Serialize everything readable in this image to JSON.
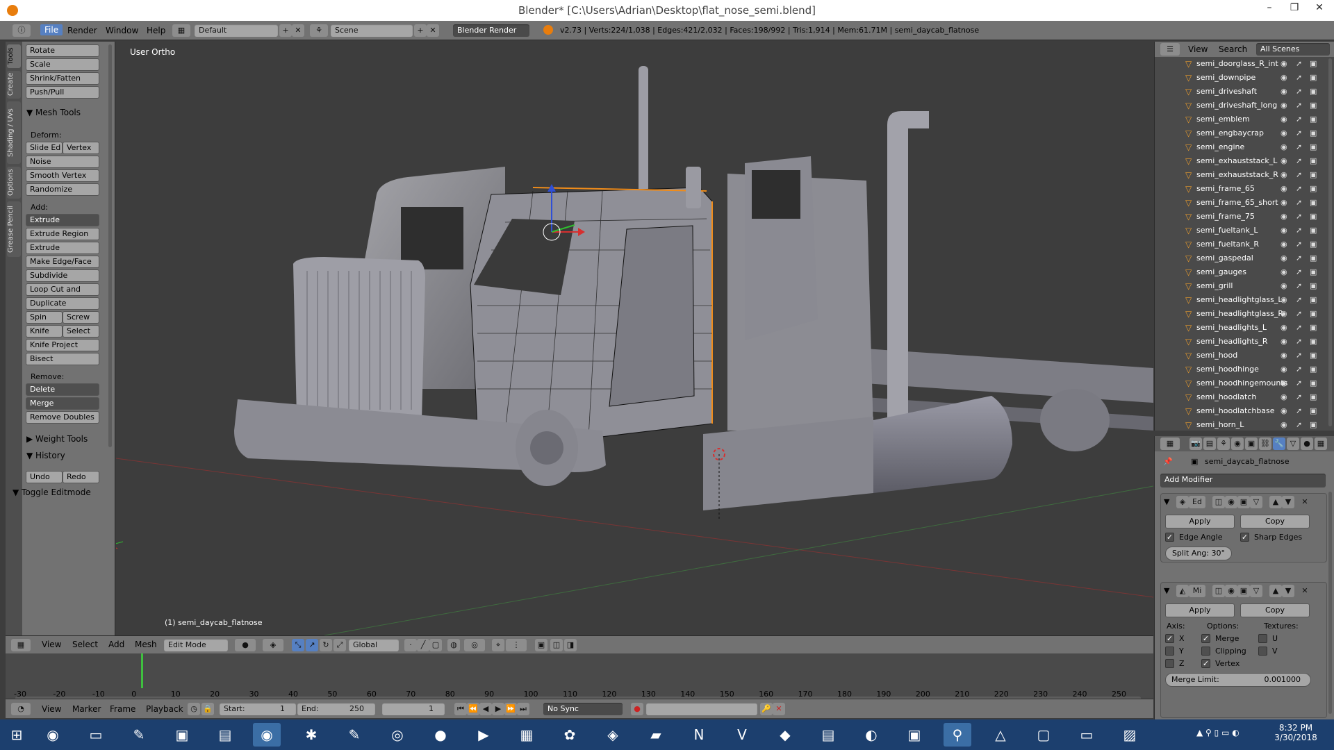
{
  "window": {
    "title": "Blender* [C:\\Users\\Adrian\\Desktop\\flat_nose_semi.blend]",
    "controls": [
      "–",
      "❐",
      "✕"
    ]
  },
  "info_header": {
    "menus": [
      "File",
      "Render",
      "Window",
      "Help"
    ],
    "layout": "Default",
    "scene": "Scene",
    "engine": "Blender Render",
    "stats": "v2.73 | Verts:224/1,038 | Edges:421/2,032 | Faces:198/992 | Tris:1,914 | Mem:61.71M | semi_daycab_flatnose"
  },
  "left_tabs": [
    "Tools",
    "Create",
    "Shading / UVs",
    "Options",
    "Grease Pencil"
  ],
  "tool_shelf": {
    "transform_buttons": [
      "Rotate",
      "Scale",
      "Shrink/Fatten",
      "Push/Pull"
    ],
    "mesh_tools_header": "Mesh Tools",
    "deform_label": "Deform:",
    "deform_row": [
      "Slide Ed",
      "Vertex"
    ],
    "deform_buttons": [
      "Noise",
      "Smooth Vertex",
      "Randomize"
    ],
    "add_label": "Add:",
    "extrude": "Extrude",
    "add_buttons": [
      "Extrude Region",
      "Extrude Individual",
      "Make Edge/Face",
      "Subdivide",
      "Loop Cut and Slide",
      "Duplicate"
    ],
    "spin_row": [
      "Spin",
      "Screw"
    ],
    "knife_row": [
      "Knife",
      "Select"
    ],
    "add_buttons2": [
      "Knife Project",
      "Bisect"
    ],
    "remove_label": "Remove:",
    "delete": "Delete",
    "merge": "Merge",
    "remove_doubles": "Remove Doubles",
    "weight_tools": "Weight Tools",
    "history": "History",
    "undo": "Undo",
    "redo": "Redo",
    "toggle_editmode": "Toggle Editmode"
  },
  "viewport": {
    "view_label": "User Ortho",
    "object_label": "(1) semi_daycab_flatnose"
  },
  "viewport_header": {
    "menus": [
      "View",
      "Select",
      "Add",
      "Mesh"
    ],
    "mode": "Edit Mode",
    "orientation": "Global"
  },
  "timeline": {
    "ticks": [
      "-30",
      "-20",
      "-10",
      "0",
      "10",
      "20",
      "30",
      "40",
      "50",
      "60",
      "70",
      "80",
      "90",
      "100",
      "110",
      "120",
      "130",
      "140",
      "150",
      "160",
      "170",
      "180",
      "190",
      "200",
      "210",
      "220",
      "230",
      "240",
      "250"
    ],
    "menus": [
      "View",
      "Marker",
      "Frame",
      "Playback"
    ],
    "start": "Start:",
    "start_val": "1",
    "end": "End:",
    "end_val": "250",
    "current": "1",
    "sync": "No Sync"
  },
  "outliner": {
    "menus": [
      "View",
      "Search"
    ],
    "filter": "All Scenes",
    "items": [
      "semi_doorglass_R_int",
      "semi_downpipe",
      "semi_driveshaft",
      "semi_driveshaft_long",
      "semi_emblem",
      "semi_engbaycrap",
      "semi_engine",
      "semi_exhauststack_L",
      "semi_exhauststack_R",
      "semi_frame_65",
      "semi_frame_65_short",
      "semi_frame_75",
      "semi_fueltank_L",
      "semi_fueltank_R",
      "semi_gaspedal",
      "semi_gauges",
      "semi_grill",
      "semi_headlightglass_L",
      "semi_headlightglass_R",
      "semi_headlights_L",
      "semi_headlights_R",
      "semi_hood",
      "semi_hoodhinge",
      "semi_hoodhingemounts",
      "semi_hoodlatch",
      "semi_hoodlatchbase",
      "semi_horn_L"
    ]
  },
  "properties": {
    "object_name": "semi_daycab_flatnose",
    "add_modifier": "Add Modifier",
    "mod1": {
      "short": "Ed",
      "apply": "Apply",
      "copy": "Copy",
      "edge_angle": "Edge Angle",
      "sharp_edges": "Sharp Edges",
      "split_angle": "Split Ang: 30°"
    },
    "mod2": {
      "short": "Mi",
      "apply": "Apply",
      "copy": "Copy",
      "axis": "Axis:",
      "options": "Options:",
      "textures": "Textures:",
      "x": "X",
      "y": "Y",
      "z": "Z",
      "merge": "Merge",
      "clipping": "Clipping",
      "vertex": "Vertex",
      "u": "U",
      "v": "V",
      "merge_limit": "Merge Limit:",
      "merge_limit_val": "0.001000"
    }
  },
  "taskbar": {
    "time": "8:32 PM",
    "date": "3/30/2018"
  }
}
